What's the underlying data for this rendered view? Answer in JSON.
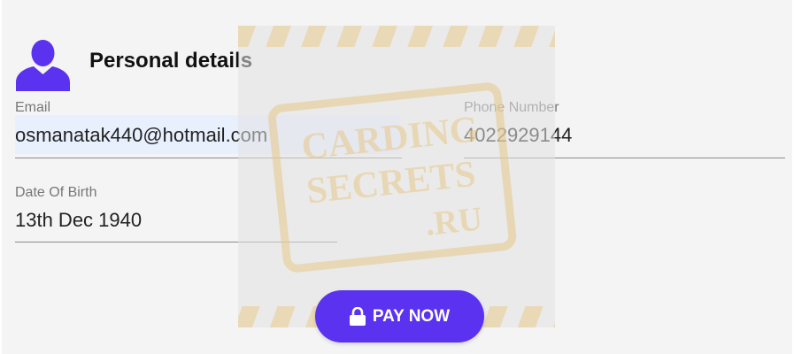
{
  "section": {
    "title": "Personal details",
    "icon": "user-icon"
  },
  "fields": {
    "email": {
      "label": "Email",
      "value": "osmanatak440@hotmail.com"
    },
    "phone": {
      "label": "Phone Number",
      "value": "4022929144"
    },
    "dob": {
      "label": "Date Of Birth",
      "value": "13th Dec 1940"
    }
  },
  "watermark": {
    "lines": [
      "CARDING",
      "SECRETS",
      ".RU"
    ]
  },
  "pay_button": {
    "label": "PAY NOW",
    "icon": "lock-icon"
  },
  "colors": {
    "accent": "#5a32f0",
    "background": "#f4f4f4",
    "autofill": "#e8f0fe",
    "watermark": "#e8c98a"
  }
}
